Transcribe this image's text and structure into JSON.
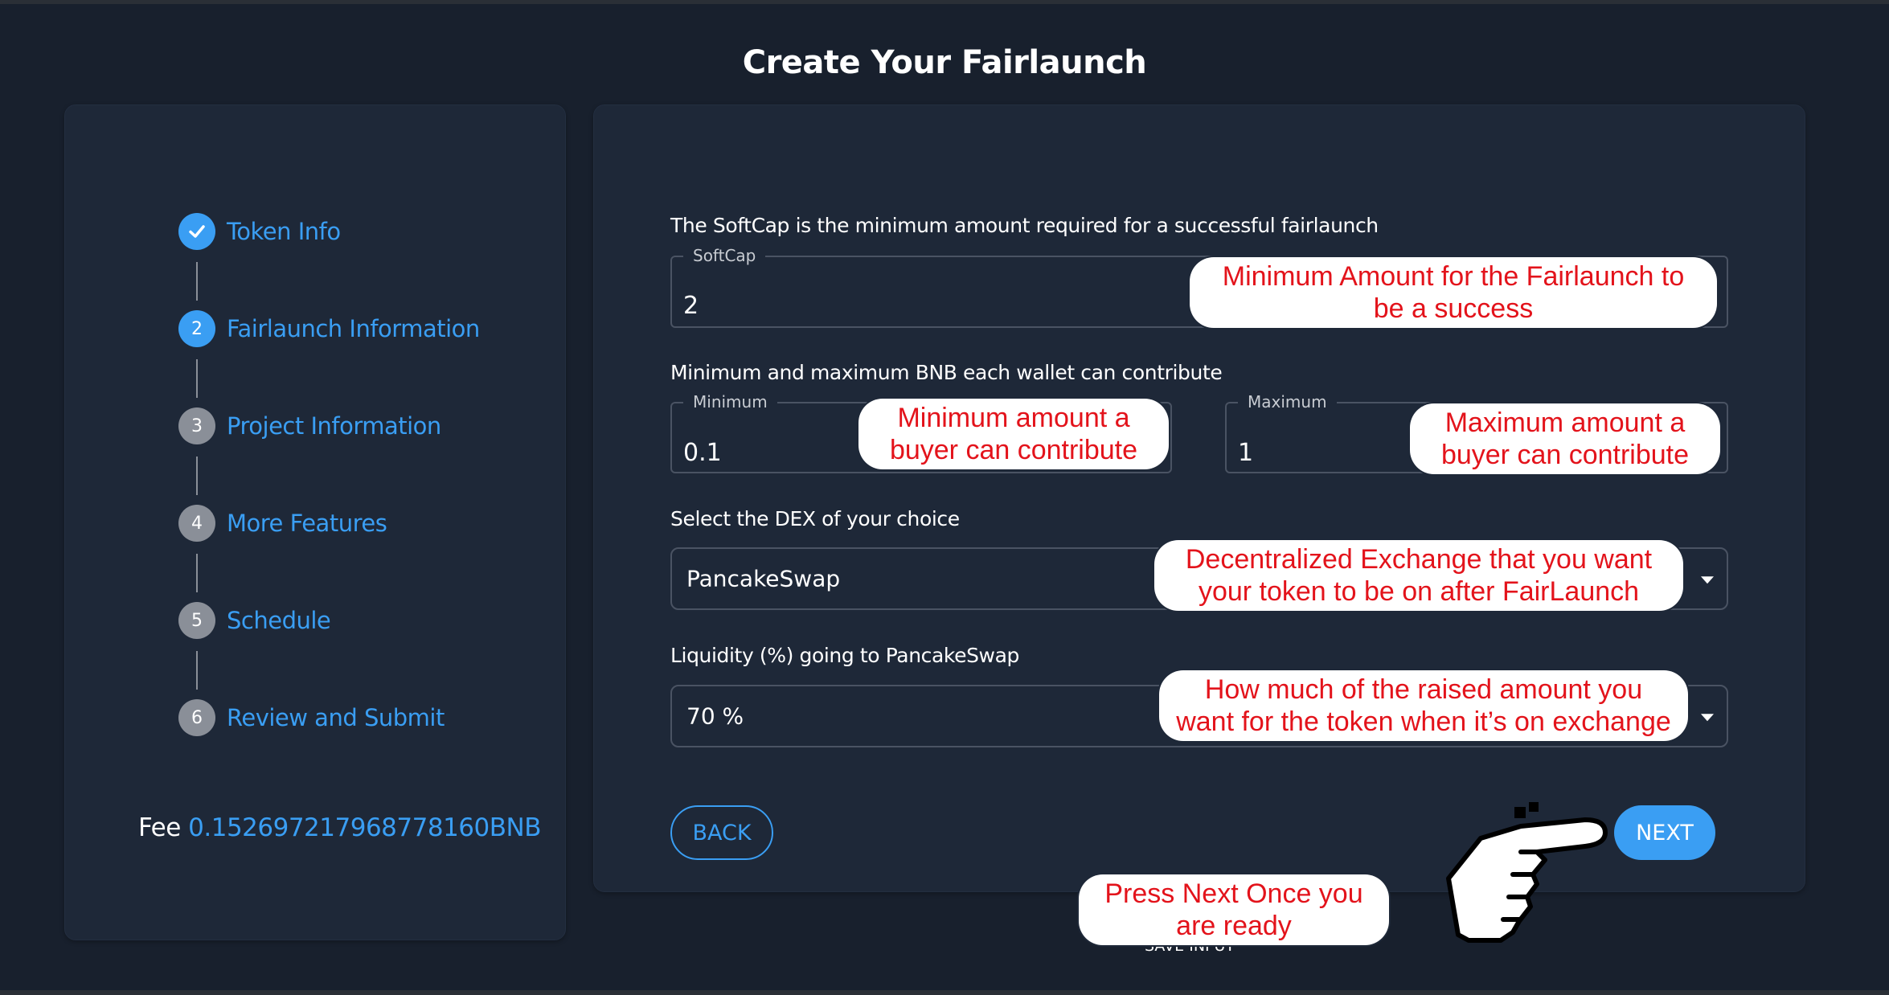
{
  "page": {
    "title": "Create Your Fairlaunch"
  },
  "steps": [
    {
      "number": "✓",
      "label": "Token Info",
      "state": "done"
    },
    {
      "number": "2",
      "label": "Fairlaunch Information",
      "state": "active"
    },
    {
      "number": "3",
      "label": "Project Information",
      "state": "pending"
    },
    {
      "number": "4",
      "label": "More Features",
      "state": "pending"
    },
    {
      "number": "5",
      "label": "Schedule",
      "state": "pending"
    },
    {
      "number": "6",
      "label": "Review and Submit",
      "state": "pending"
    }
  ],
  "fee": {
    "label": "Fee ",
    "value": "0.152697217968778160BNB"
  },
  "form": {
    "softcap_heading": "The SoftCap is the minimum amount required for a successful fairlaunch",
    "softcap_legend": "SoftCap",
    "softcap_value": "2",
    "contribution_heading": "Minimum and maximum BNB each wallet can contribute",
    "minimum_legend": "Minimum",
    "minimum_value": "0.1",
    "maximum_legend": "Maximum",
    "maximum_value": "1",
    "dex_heading": "Select the DEX of your choice",
    "dex_value": "PancakeSwap",
    "liquidity_heading": "Liquidity (%) going to PancakeSwap",
    "liquidity_value": "70 %"
  },
  "buttons": {
    "back": "BACK",
    "next": "NEXT",
    "save_input": "SAVE INPUT"
  },
  "annotations": {
    "softcap": "Minimum Amount for the Fairlaunch to\nbe a success",
    "minimum": "Minimum amount a\nbuyer can contribute",
    "maximum": "Maximum amount a\nbuyer can contribute",
    "dex": "Decentralized Exchange that you want\nyour token to be on after FairLaunch",
    "liquidity": "How much of the raised amount you\nwant for the token when it’s on exchange",
    "next": "Press Next Once you\nare ready"
  },
  "colors": {
    "accent": "#3a9ef3",
    "background": "#18202d",
    "panel": "#1e2838",
    "annotation_text": "#e3131b"
  },
  "icons": {
    "done_step": "check-icon",
    "dropdown": "caret-down-icon",
    "pointer": "pointing-hand-icon"
  }
}
